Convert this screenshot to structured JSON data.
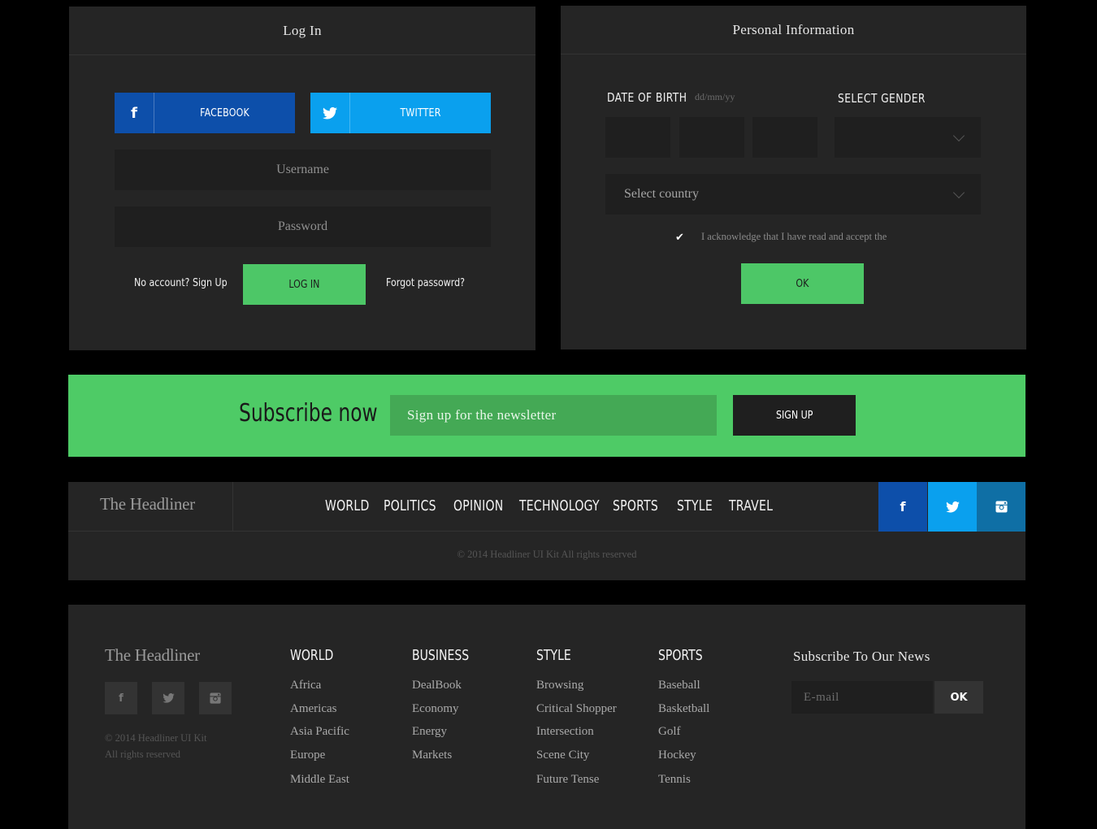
{
  "login": {
    "title": "Log In",
    "facebook_icon": "f",
    "facebook_label": "FACEBOOK",
    "twitter_label": "TWITTER",
    "username_placeholder": "Username",
    "password_placeholder": "Password",
    "signup_link": "No account? Sign Up",
    "login_button": "LOG IN",
    "forgot_link": "Forgot passowrd?"
  },
  "personal": {
    "title": "Personal Information",
    "dob_label": "DATE OF BIRTH",
    "dob_hint": "dd/mm/yy",
    "gender_label": "SELECT GENDER",
    "country_placeholder": "Select country",
    "checkmark": "✔",
    "acknowledge_text": "I acknowledge that I have read and accept the",
    "ok_button": "OK"
  },
  "subscribe": {
    "title": "Subscribe now",
    "input_placeholder": "Sign up for the newsletter",
    "button": "SIGN UP"
  },
  "navbar": {
    "brand": "The Headliner",
    "items": [
      "WORLD",
      "POLITICS",
      "OPINION",
      "TECHNOLOGY",
      "SPORTS",
      "STYLE",
      "TRAVEL"
    ],
    "facebook_icon": "f",
    "copyright": "© 2014 Headliner UI Kit All rights reserved"
  },
  "footer": {
    "brand": "The Headliner",
    "facebook_icon": "f",
    "copyright_line1": "© 2014 Headliner UI Kit",
    "copyright_line2": "All rights reserved",
    "columns": [
      {
        "title": "WORLD",
        "items": [
          "Africa",
          "Americas",
          "Asia Pacific",
          "Europe",
          "Middle East"
        ]
      },
      {
        "title": "BUSINESS",
        "items": [
          "DealBook",
          "Economy",
          "Energy",
          "Markets"
        ]
      },
      {
        "title": "STYLE",
        "items": [
          "Browsing",
          "Critical Shopper",
          "Intersection",
          "Scene City",
          "Future Tense"
        ]
      },
      {
        "title": "SPORTS",
        "items": [
          "Baseball",
          "Basketball",
          "Golf",
          "Hockey",
          "Tennis"
        ]
      }
    ],
    "newsletter_title": "Subscribe To Our News",
    "email_placeholder": "E-mail",
    "ok_button": "OK"
  },
  "colors": {
    "background": "#000000",
    "panel": "#252525",
    "field": "#1f1f1f",
    "accent_green": "#4ecb66",
    "facebook_blue": "#0d4faa",
    "twitter_blue": "#0aa0ee",
    "instagram_blue": "#0f6fa5"
  },
  "icons": [
    "facebook-icon",
    "twitter-icon",
    "instagram-icon",
    "chevron-down-icon",
    "checkmark-icon"
  ]
}
